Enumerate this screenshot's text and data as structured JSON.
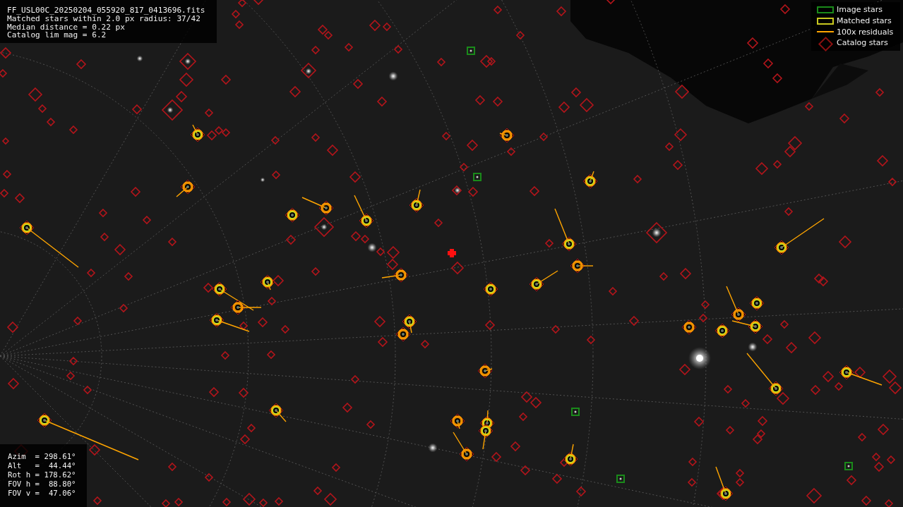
{
  "info_panel": {
    "lines": [
      "FF_USL00C_20250204_055920_817_0413696.fits",
      "Matched stars within 2.0 px radius: 37/42",
      "Median distance = 0.22 px",
      "Catalog lim mag = 6.2"
    ]
  },
  "legend": {
    "items": [
      {
        "kind": "image",
        "label": "Image stars"
      },
      {
        "kind": "matched",
        "label": "Matched stars"
      },
      {
        "kind": "residual",
        "label": "100x residuals"
      },
      {
        "kind": "catalog",
        "label": "Catalog stars"
      }
    ]
  },
  "pointing_panel": {
    "lines": [
      "Azim  = 298.61°",
      "Alt   =  44.44°",
      "Rot h = 178.62°",
      "FOV h =  88.80°",
      "FOV v =  47.06°"
    ]
  }
}
